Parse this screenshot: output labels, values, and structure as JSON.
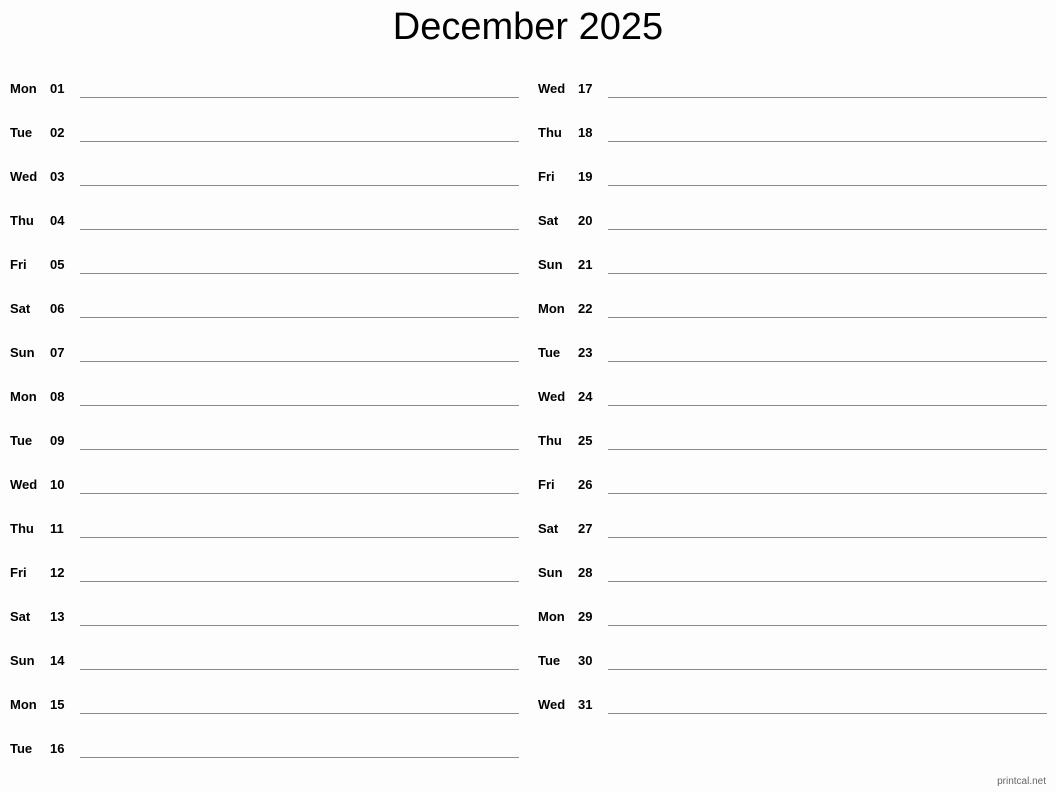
{
  "title": "December 2025",
  "footer": "printcal.net",
  "left_column": [
    {
      "day": "Mon",
      "date": "01"
    },
    {
      "day": "Tue",
      "date": "02"
    },
    {
      "day": "Wed",
      "date": "03"
    },
    {
      "day": "Thu",
      "date": "04"
    },
    {
      "day": "Fri",
      "date": "05"
    },
    {
      "day": "Sat",
      "date": "06"
    },
    {
      "day": "Sun",
      "date": "07"
    },
    {
      "day": "Mon",
      "date": "08"
    },
    {
      "day": "Tue",
      "date": "09"
    },
    {
      "day": "Wed",
      "date": "10"
    },
    {
      "day": "Thu",
      "date": "11"
    },
    {
      "day": "Fri",
      "date": "12"
    },
    {
      "day": "Sat",
      "date": "13"
    },
    {
      "day": "Sun",
      "date": "14"
    },
    {
      "day": "Mon",
      "date": "15"
    },
    {
      "day": "Tue",
      "date": "16"
    }
  ],
  "right_column": [
    {
      "day": "Wed",
      "date": "17"
    },
    {
      "day": "Thu",
      "date": "18"
    },
    {
      "day": "Fri",
      "date": "19"
    },
    {
      "day": "Sat",
      "date": "20"
    },
    {
      "day": "Sun",
      "date": "21"
    },
    {
      "day": "Mon",
      "date": "22"
    },
    {
      "day": "Tue",
      "date": "23"
    },
    {
      "day": "Wed",
      "date": "24"
    },
    {
      "day": "Thu",
      "date": "25"
    },
    {
      "day": "Fri",
      "date": "26"
    },
    {
      "day": "Sat",
      "date": "27"
    },
    {
      "day": "Sun",
      "date": "28"
    },
    {
      "day": "Mon",
      "date": "29"
    },
    {
      "day": "Tue",
      "date": "30"
    },
    {
      "day": "Wed",
      "date": "31"
    }
  ]
}
